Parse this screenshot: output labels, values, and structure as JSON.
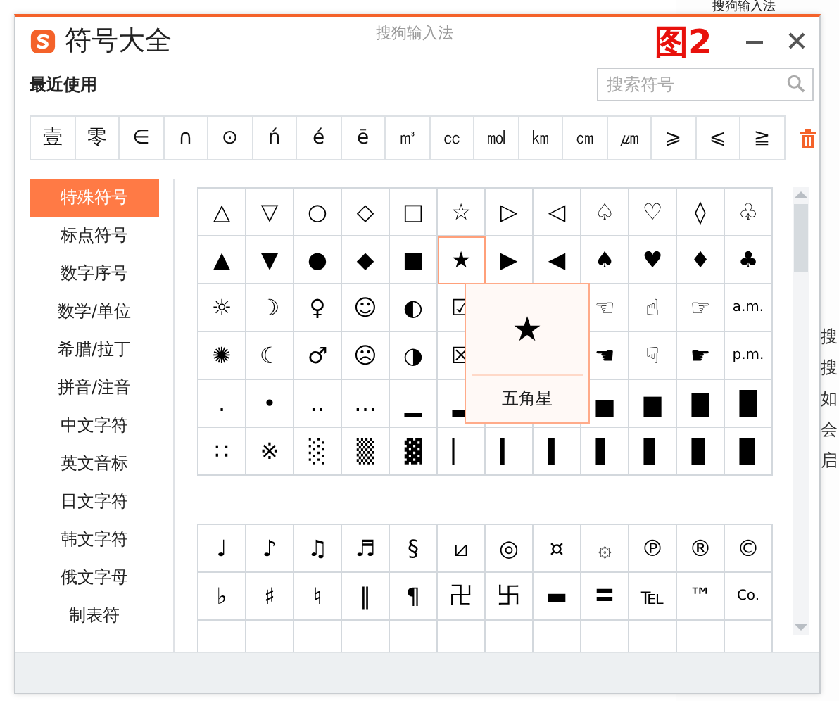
{
  "background_window": {
    "title": "搜狗输入法",
    "fragments": [
      "搜",
      "搜",
      "如",
      "会",
      "启"
    ]
  },
  "window": {
    "title": "符号大全",
    "subtitle": "搜狗输入法"
  },
  "annotation": "图2",
  "recent": {
    "label": "最近使用",
    "symbols": [
      "壹",
      "零",
      "∈",
      "∩",
      "⊙",
      "ń",
      "é",
      "ē",
      "㎥",
      "㏄",
      "㏖",
      "㎞",
      "㎝",
      "㎛",
      "⩾",
      "⩽",
      "≧"
    ]
  },
  "search": {
    "placeholder": "搜索符号"
  },
  "sidebar": {
    "items": [
      {
        "label": "特殊符号",
        "selected": true
      },
      {
        "label": "标点符号",
        "selected": false
      },
      {
        "label": "数字序号",
        "selected": false
      },
      {
        "label": "数学/单位",
        "selected": false
      },
      {
        "label": "希腊/拉丁",
        "selected": false
      },
      {
        "label": "拼音/注音",
        "selected": false
      },
      {
        "label": "中文字符",
        "selected": false
      },
      {
        "label": "英文音标",
        "selected": false
      },
      {
        "label": "日文字符",
        "selected": false
      },
      {
        "label": "韩文字符",
        "selected": false
      },
      {
        "label": "俄文字母",
        "selected": false
      },
      {
        "label": "制表符",
        "selected": false
      }
    ]
  },
  "sections": [
    {
      "rows": [
        [
          {
            "s": "△",
            "selected": false
          },
          {
            "s": "▽",
            "selected": false
          },
          {
            "s": "○",
            "selected": false
          },
          {
            "s": "◇",
            "selected": false
          },
          {
            "s": "□",
            "selected": false
          },
          {
            "s": "☆",
            "selected": false
          },
          {
            "s": "▷",
            "selected": false
          },
          {
            "s": "◁",
            "selected": false
          },
          {
            "s": "♤",
            "selected": false
          },
          {
            "s": "♡",
            "selected": false
          },
          {
            "s": "◊",
            "selected": false
          },
          {
            "s": "♧",
            "selected": false
          }
        ],
        [
          {
            "s": "▲",
            "selected": false
          },
          {
            "s": "▼",
            "selected": false
          },
          {
            "s": "●",
            "selected": false
          },
          {
            "s": "◆",
            "selected": false
          },
          {
            "s": "■",
            "selected": false
          },
          {
            "s": "★",
            "selected": true
          },
          {
            "s": "▶",
            "selected": false
          },
          {
            "s": "◀",
            "selected": false
          },
          {
            "s": "♠",
            "selected": false
          },
          {
            "s": "♥",
            "selected": false
          },
          {
            "s": "♦",
            "selected": false
          },
          {
            "s": "♣",
            "selected": false
          }
        ],
        [
          {
            "s": "☼",
            "selected": false
          },
          {
            "s": "☽",
            "selected": false
          },
          {
            "s": "♀",
            "selected": false
          },
          {
            "s": "☺",
            "selected": false
          },
          {
            "s": "◐",
            "selected": false
          },
          {
            "s": "☑",
            "selected": false
          },
          {},
          {},
          {
            "s": "☜",
            "selected": false
          },
          {
            "s": "☝",
            "selected": false
          },
          {
            "s": "☞",
            "selected": false
          },
          {
            "s": "a.m.",
            "selected": false
          }
        ],
        [
          {
            "s": "✺",
            "selected": false
          },
          {
            "s": "☾",
            "selected": false
          },
          {
            "s": "♂",
            "selected": false
          },
          {
            "s": "☹",
            "selected": false
          },
          {
            "s": "◑",
            "selected": false
          },
          {
            "s": "☒",
            "selected": false
          },
          {},
          {},
          {
            "s": "☚",
            "selected": false
          },
          {
            "s": "☟",
            "selected": false
          },
          {
            "s": "☛",
            "selected": false
          },
          {
            "s": "p.m.",
            "selected": false
          }
        ],
        [
          {
            "s": ".",
            "selected": false
          },
          {
            "s": "•",
            "selected": false
          },
          {
            "s": "‥",
            "selected": false
          },
          {
            "s": "…",
            "selected": false
          },
          {
            "s": "▁",
            "selected": false
          },
          {
            "s": "▂",
            "selected": false
          },
          {},
          {},
          {
            "s": "▅",
            "selected": false
          },
          {
            "s": "▆",
            "selected": false
          },
          {
            "s": "▇",
            "selected": false
          },
          {
            "s": "█",
            "selected": false
          }
        ],
        [
          {
            "s": "∷",
            "selected": false
          },
          {
            "s": "※",
            "selected": false
          },
          {
            "s": "░",
            "selected": false
          },
          {
            "s": "▒",
            "selected": false
          },
          {
            "s": "▓",
            "selected": false
          },
          {
            "s": "▏",
            "selected": false
          },
          {
            "s": "▎",
            "selected": false
          },
          {
            "s": "▍",
            "selected": false
          },
          {
            "s": "▌",
            "selected": false
          },
          {
            "s": "▋",
            "selected": false
          },
          {
            "s": "▊",
            "selected": false
          },
          {
            "s": "▉",
            "selected": false
          }
        ]
      ]
    },
    {
      "rows": [
        [
          {
            "s": "♩",
            "selected": false
          },
          {
            "s": "♪",
            "selected": false
          },
          {
            "s": "♫",
            "selected": false
          },
          {
            "s": "♬",
            "selected": false
          },
          {
            "s": "§",
            "selected": false
          },
          {
            "s": "⧄",
            "selected": false
          },
          {
            "s": "◎",
            "selected": false
          },
          {
            "s": "¤",
            "selected": false
          },
          {
            "s": "۞",
            "selected": false
          },
          {
            "s": "℗",
            "selected": false
          },
          {
            "s": "®",
            "selected": false
          },
          {
            "s": "©",
            "selected": false
          }
        ],
        [
          {
            "s": "♭",
            "selected": false
          },
          {
            "s": "♯",
            "selected": false
          },
          {
            "s": "♮",
            "selected": false
          },
          {
            "s": "‖",
            "selected": false
          },
          {
            "s": "¶",
            "selected": false
          },
          {
            "s": "卍",
            "selected": false
          },
          {
            "s": "卐",
            "selected": false
          },
          {
            "s": "▬",
            "selected": false
          },
          {
            "s": "〓",
            "selected": false
          },
          {
            "s": "℡",
            "selected": false
          },
          {
            "s": "™",
            "selected": false
          },
          {
            "s": "Co.",
            "selected": false
          }
        ],
        [
          {
            "selected": false
          },
          {
            "selected": false
          },
          {
            "selected": false
          },
          {
            "selected": false
          },
          {
            "selected": false
          },
          {
            "selected": false
          },
          {
            "selected": false
          },
          {
            "selected": false
          },
          {
            "selected": false
          },
          {
            "selected": false
          },
          {
            "selected": false
          },
          {
            "selected": false
          }
        ]
      ]
    }
  ],
  "tooltip": {
    "symbol": "★",
    "name": "五角星"
  }
}
